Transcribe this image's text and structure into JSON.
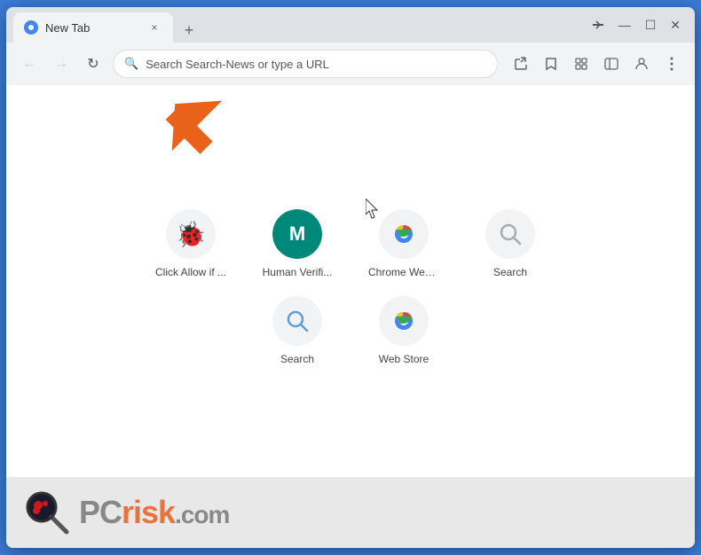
{
  "window": {
    "title": "New Tab",
    "tab_close": "×",
    "new_tab_btn": "+",
    "controls": {
      "minimize": "—",
      "maximize": "☐",
      "close": "✕"
    }
  },
  "nav": {
    "back": "←",
    "forward": "→",
    "refresh": "↻",
    "address_placeholder": "Search Search-News or type a URL",
    "icons": {
      "share": "↑",
      "bookmark": "☆",
      "extensions": "⊕",
      "sidebar": "▤",
      "profile": "◯",
      "menu": "⋮"
    }
  },
  "shortcuts": {
    "row1": [
      {
        "id": "click-allow",
        "label": "Click Allow if ...",
        "icon_type": "bug"
      },
      {
        "id": "human-verif",
        "label": "Human Verifi...",
        "icon_type": "m"
      },
      {
        "id": "chrome-web",
        "label": "Chrome Web ...",
        "icon_type": "chrome"
      },
      {
        "id": "search1",
        "label": "Search",
        "icon_type": "search-gray"
      }
    ],
    "row2": [
      {
        "id": "search2",
        "label": "Search",
        "icon_type": "search-blue"
      },
      {
        "id": "web-store",
        "label": "Web Store",
        "icon_type": "chrome2"
      }
    ]
  },
  "footer": {
    "brand": "PC",
    "brand_accent": "risk",
    "domain": ".com"
  }
}
